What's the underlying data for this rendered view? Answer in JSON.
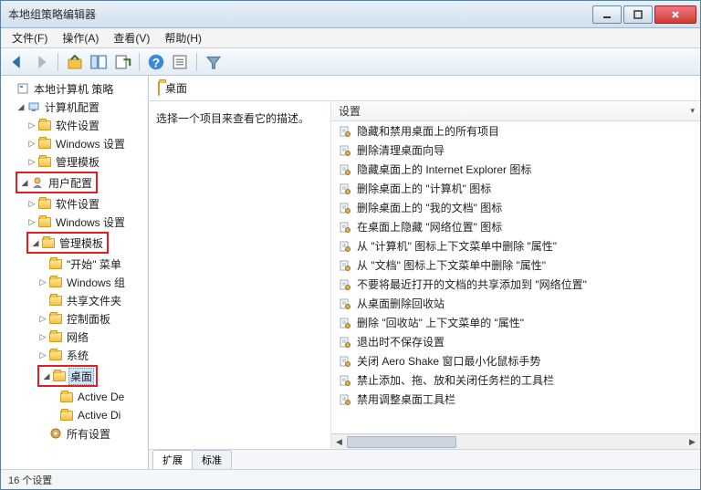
{
  "window": {
    "title": "本地组策略编辑器"
  },
  "menu": {
    "file": "文件(F)",
    "action": "操作(A)",
    "view": "查看(V)",
    "help": "帮助(H)"
  },
  "tree": {
    "root": "本地计算机 策略",
    "computer_config": "计算机配置",
    "cc_software": "软件设置",
    "cc_windows": "Windows 设置",
    "cc_admin": "管理模板",
    "user_config": "用户配置",
    "uc_software": "软件设置",
    "uc_windows": "Windows 设置",
    "uc_admin": "管理模板",
    "start_menu": "\"开始\" 菜单",
    "windows_components": "Windows 组",
    "shared_folders": "共享文件夹",
    "control_panel": "控制面板",
    "network": "网络",
    "system": "系统",
    "desktop": "桌面",
    "active_de": "Active De",
    "active_di": "Active Di",
    "all_settings": "所有设置"
  },
  "main": {
    "header_title": "桌面",
    "description_prompt": "选择一个项目来查看它的描述。",
    "column_header": "设置"
  },
  "settings": [
    "隐藏和禁用桌面上的所有项目",
    "删除清理桌面向导",
    "隐藏桌面上的 Internet Explorer 图标",
    "删除桌面上的 \"计算机\" 图标",
    "删除桌面上的 \"我的文档\" 图标",
    "在桌面上隐藏 \"网络位置\" 图标",
    "从 \"计算机\" 图标上下文菜单中删除 \"属性\"",
    "从 \"文档\" 图标上下文菜单中删除 \"属性\"",
    "不要将最近打开的文档的共享添加到 \"网络位置\"",
    "从桌面删除回收站",
    "删除 \"回收站\" 上下文菜单的 \"属性\"",
    "退出时不保存设置",
    "关闭 Aero Shake 窗口最小化鼠标手势",
    "禁止添加、拖、放和关闭任务栏的工具栏",
    "禁用调整桌面工具栏"
  ],
  "tabs": {
    "extended": "扩展",
    "standard": "标准"
  },
  "statusbar": {
    "count": "16 个设置"
  },
  "icons": {
    "back": "back-icon",
    "forward": "forward-icon",
    "up": "up-icon",
    "props": "properties-icon",
    "refresh": "refresh-icon",
    "export": "export-icon",
    "help": "help-icon",
    "list": "list-icon",
    "filter": "filter-icon"
  }
}
